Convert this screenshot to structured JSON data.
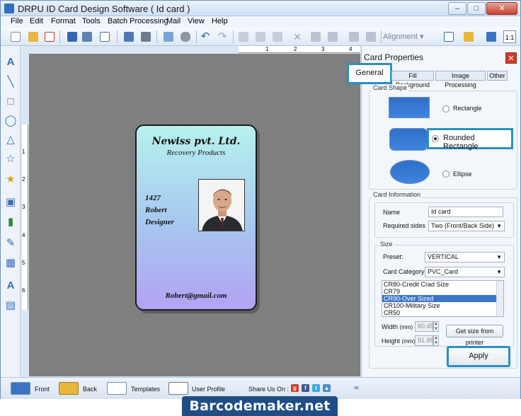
{
  "window": {
    "title": "DRPU ID Card Design Software ( Id card )"
  },
  "menu": [
    "File",
    "Edit",
    "Format",
    "Tools",
    "Batch Processing",
    "Mail",
    "View",
    "Help"
  ],
  "toolbar": {
    "alignment_label": "Alignment"
  },
  "ruler": {
    "top_ticks": [
      "1",
      "2",
      "3",
      "4"
    ],
    "left_ticks": [
      "1",
      "2",
      "3",
      "4",
      "5",
      "6"
    ]
  },
  "card": {
    "company": "Newiss pvt. Ltd.",
    "subtitle": "Recovery Products",
    "id_number": "1427",
    "name": "Robert",
    "designation": "Designer",
    "email": "Robert@gmail.com"
  },
  "panel": {
    "title": "Card Properties",
    "tabs": [
      "General",
      "Fill Background",
      "Image Processing",
      "Other"
    ],
    "active_tab": "General",
    "card_shape": {
      "label": "Card Shape",
      "options": [
        "Rectangle",
        "Rounded Rectangle",
        "Ellipse"
      ],
      "selected": "Rounded Rectangle"
    },
    "card_info": {
      "label": "Card Information",
      "name_label": "Name",
      "name_value": "Id card",
      "sides_label": "Required sides",
      "sides_value": "Two (Front/Back Side)"
    },
    "size": {
      "label": "Size",
      "preset_label": "Preset:",
      "preset_value": "VERTICAL",
      "category_label": "Card Category",
      "category_value": "PVC_Card",
      "list_items": [
        "CR80-Credit Crad Size",
        "CR79",
        "CR90-Over Sized",
        "CR100-Military Size",
        "CR50"
      ],
      "selected_item": "CR90-Over Sized",
      "width_label": "Width",
      "height_label": "Height",
      "unit": "(mm)",
      "width_value": "60.45",
      "height_value": "91.95",
      "get_size_button": "Get size from printer"
    },
    "apply_button": "Apply"
  },
  "bottombar": {
    "front": "Front",
    "back": "Back",
    "templates": "Templates",
    "user_profile": "User Profile",
    "share": "Share Us On :"
  },
  "banner": "Barcodemaker.net",
  "colors": {
    "accent": "#2a8fc4",
    "canvas": "#7f7f7f",
    "banner": "#1f4d86"
  }
}
